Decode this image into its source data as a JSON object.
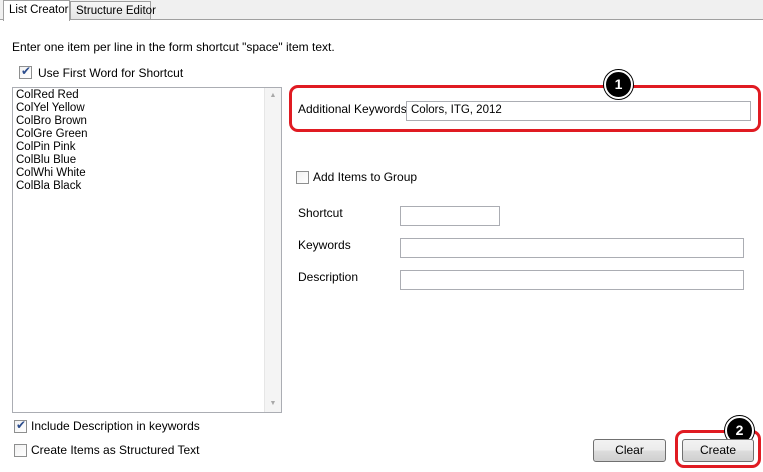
{
  "tabs": [
    {
      "label": "List Creator",
      "active": true
    },
    {
      "label": "Structure Editor",
      "active": false
    }
  ],
  "instructions": "Enter one item per line in the form shortcut \"space\" item text.",
  "use_first_word": {
    "label": "Use First Word for Shortcut",
    "checked": true
  },
  "list_items": [
    "ColRed Red",
    "ColYel Yellow",
    "ColBro Brown",
    "ColGre Green",
    "ColPin Pink",
    "ColBlu Blue",
    "ColWhi White",
    "ColBla Black"
  ],
  "additional_keywords": {
    "label": "Additional Keywords",
    "value": "Colors, ITG, 2012"
  },
  "add_items_to_group": {
    "label": "Add Items to Group",
    "checked": false
  },
  "shortcut": {
    "label": "Shortcut",
    "value": ""
  },
  "keywords": {
    "label": "Keywords",
    "value": ""
  },
  "description": {
    "label": "Description",
    "value": ""
  },
  "include_description": {
    "label": "Include Description in keywords",
    "checked": true
  },
  "structured_text": {
    "label": "Create Items as Structured Text",
    "checked": false
  },
  "buttons": {
    "clear": "Clear",
    "create": "Create"
  },
  "callouts": {
    "one": "1",
    "two": "2"
  },
  "colors": {
    "callout_border": "#e01b22",
    "badge": "#000000"
  }
}
